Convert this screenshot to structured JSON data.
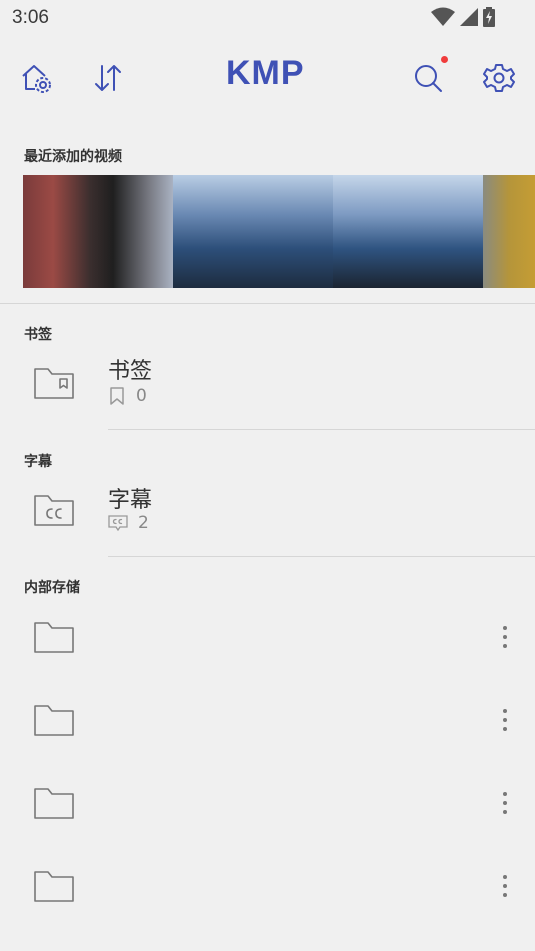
{
  "status": {
    "time": "3:06"
  },
  "app": {
    "logo": "KMP",
    "accent": "#3f51b5",
    "notify_dot": "#f03c3c"
  },
  "toolbar": {
    "icons": [
      "home-settings-icon",
      "sort-icon",
      "search-icon",
      "settings-icon"
    ]
  },
  "recent": {
    "title": "最近添加的视频",
    "thumbnail_colors": [
      "#8a4040",
      "#2b2b2b",
      "#6d7f9c",
      "#1f3757",
      "#335f8f",
      "#1e2b3a",
      "#5d6f8c",
      "#b7952d"
    ]
  },
  "bookmarks": {
    "section_title": "书签",
    "label": "书签",
    "count": "0"
  },
  "subtitles": {
    "section_title": "字幕",
    "label": "字幕",
    "count": "2"
  },
  "storage": {
    "section_title": "内部存储",
    "folders": [
      {
        "name": ""
      },
      {
        "name": ""
      },
      {
        "name": ""
      },
      {
        "name": ""
      }
    ]
  }
}
